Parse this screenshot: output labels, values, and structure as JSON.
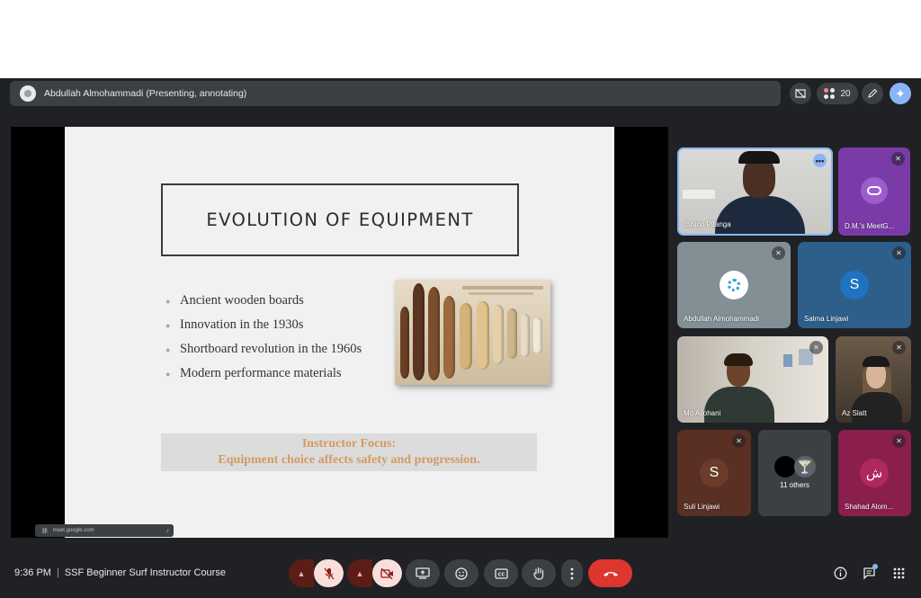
{
  "presenting_bar": {
    "label": "Abdullah Almohammadi (Presenting, annotating)"
  },
  "top_controls": {
    "participant_count": "20"
  },
  "slide": {
    "title": "EVOLUTION OF EQUIPMENT",
    "bullets": [
      "Ancient wooden boards",
      "Innovation in the 1930s",
      "Shortboard revolution in the 1960s",
      "Modern performance materials"
    ],
    "focus_line1": "Instructor Focus:",
    "focus_line2": "Equipment choice affects safety and progression."
  },
  "url_chip": {
    "text": "meet.google.com"
  },
  "participants": {
    "bruno": "Bruno Pitanga",
    "dm": "D.M.'s MeetG...",
    "abdullah": "Abdullah Almohammadi",
    "salma": "Salma Linjawi",
    "salma_initial": "S",
    "mo": "Mo Aljohani",
    "az": "Az Slatt",
    "suli": "Suli Linjawi",
    "suli_initial": "S",
    "others": "11 others",
    "shahad": "Shahad Alom...",
    "shahad_initial": "ش"
  },
  "bottom_bar": {
    "time": "9:36 PM",
    "separator": "|",
    "meeting_title": "SSF Beginner Surf Instructor Course"
  },
  "icons": {
    "mic": "mic-off-icon",
    "camera": "camera-off-icon",
    "present": "present-screen-icon",
    "emoji": "emoji-icon",
    "captions": "captions-icon",
    "hand": "raise-hand-icon",
    "more": "more-vert-icon",
    "leave": "end-call-icon",
    "info": "info-icon",
    "chat": "chat-icon",
    "activities": "activities-icon"
  },
  "colors": {
    "leave": "#dc362e",
    "accent": "#8ab4f8",
    "muted_control": "#f9dedc",
    "focus_text": "#d39a62"
  }
}
